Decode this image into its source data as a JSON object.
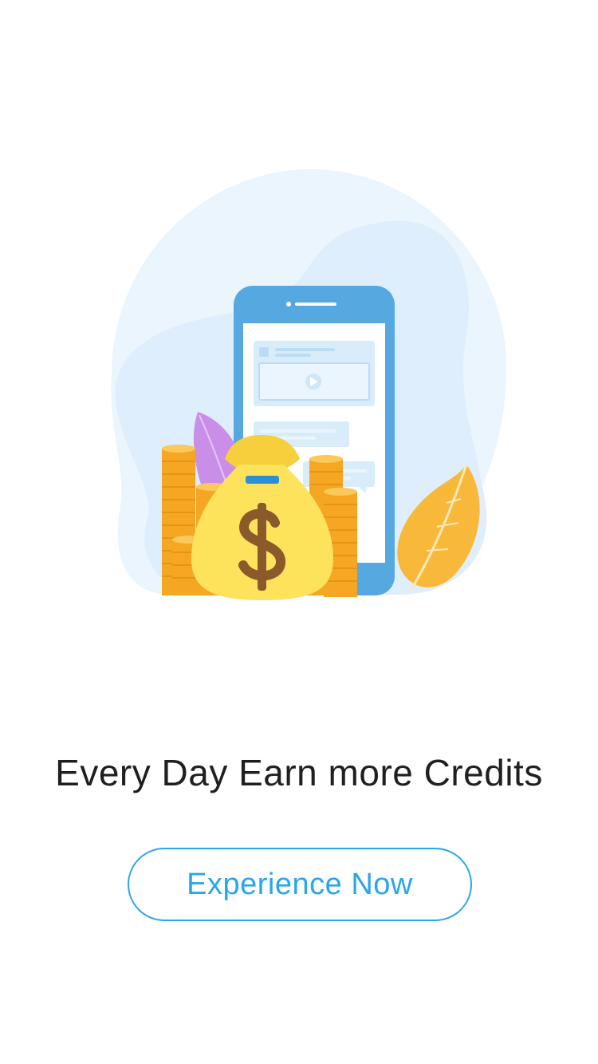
{
  "onboarding": {
    "tagline": "Every Day Earn more Credits",
    "cta_label": "Experience Now",
    "illustration_icons": [
      "smartphone-icon",
      "money-bag-icon",
      "dollar-sign-icon",
      "coin-stack-icon",
      "leaf-icon",
      "play-icon",
      "chat-bubble-icon"
    ]
  },
  "colors": {
    "accent": "#2aa6ec",
    "text": "#1f1f1f",
    "background": "#ffffff",
    "phone": "#55a8e0",
    "coin": "#f5a623",
    "bag": "#fde35c",
    "dollar": "#8a5a2b",
    "leaf_orange": "#f8b83a",
    "leaf_purple": "#c88ee8"
  }
}
